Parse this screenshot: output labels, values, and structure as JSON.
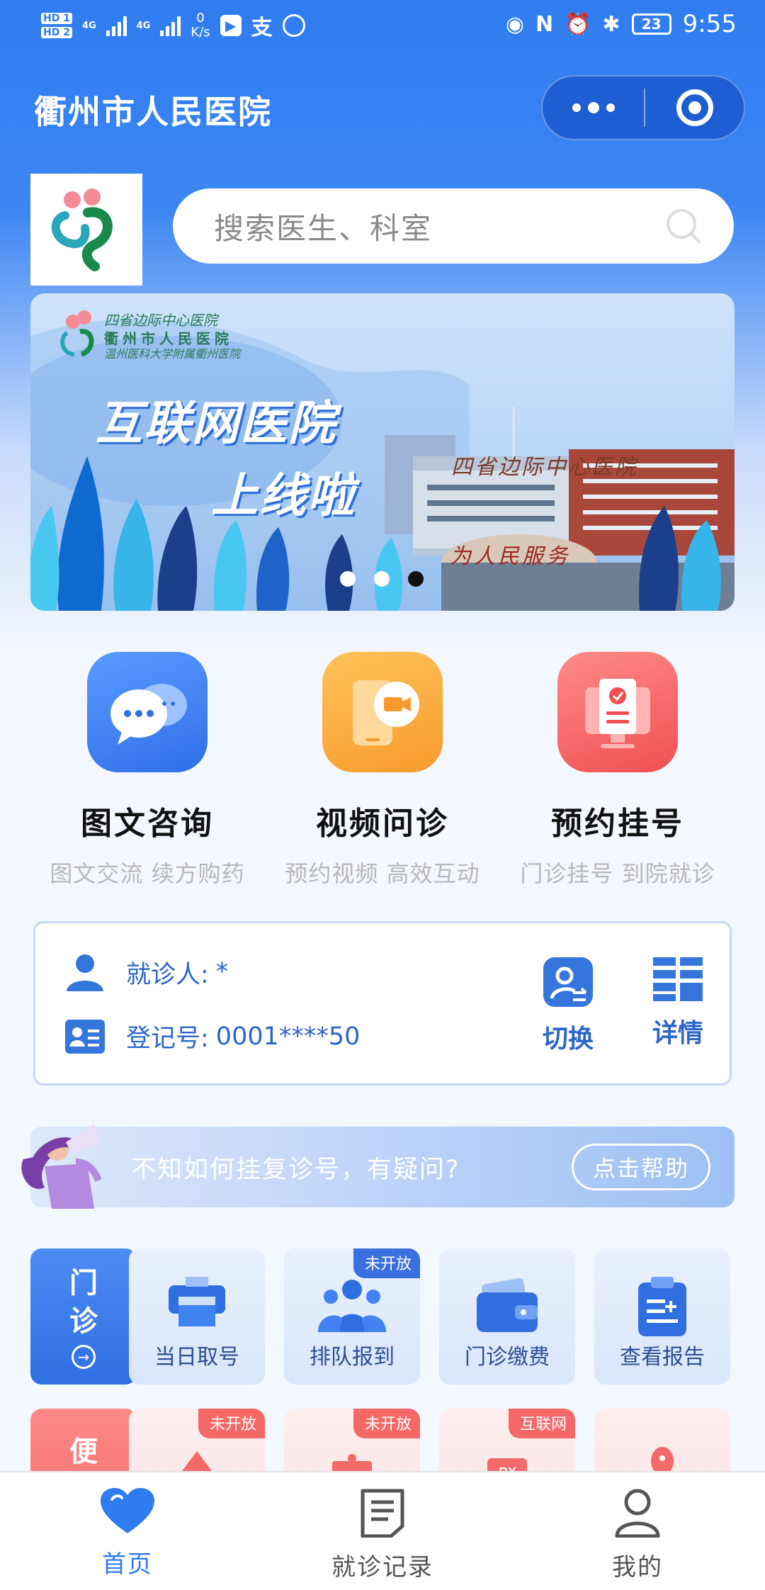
{
  "status_bar": {
    "hd1": "HD 1",
    "hd2": "HD 2",
    "net1": "4G",
    "net2": "4G",
    "speed_value": "0",
    "speed_unit": "K/s",
    "app_label": "支",
    "battery": "23",
    "time": "9:55"
  },
  "header": {
    "title": "衢州市人民医院"
  },
  "search": {
    "placeholder": "搜索医生、科室"
  },
  "banner": {
    "title_line1": "互联网医院",
    "title_line2": "上线啦",
    "org_line1": "四省边际中心医院",
    "org_line2": "衢州市人民医院",
    "org_line3": "温州医科大学附属衢州医院",
    "building_sign": "四省边际中心医院",
    "rock_text": "为人民服务",
    "slide_count": 3,
    "active_slide": 3
  },
  "services": [
    {
      "name": "图文咨询",
      "desc": "图文交流 续方购药",
      "icon": "chat-bubbles-icon",
      "color": "#3f7ff0"
    },
    {
      "name": "视频问诊",
      "desc": "预约视频 高效互动",
      "icon": "video-phone-icon",
      "color": "#f7a23b"
    },
    {
      "name": "预约挂号",
      "desc": "门诊挂号 到院就诊",
      "icon": "appointment-screen-icon",
      "color": "#f45f5f"
    }
  ],
  "patient": {
    "name_label": "就诊人:",
    "name_value": "*",
    "reg_label": "登记号:",
    "reg_value": "0001****50",
    "switch_label": "切换",
    "detail_label": "详情"
  },
  "help": {
    "text": "不知如何挂复诊号，有疑问?",
    "button": "点击帮助"
  },
  "outpatient": {
    "tag": [
      "门",
      "诊"
    ],
    "tiles": [
      {
        "label": "当日取号",
        "badge": "",
        "icon": "ticket-printer-icon"
      },
      {
        "label": "排队报到",
        "badge": "未开放",
        "icon": "queue-people-icon"
      },
      {
        "label": "门诊缴费",
        "badge": "",
        "icon": "wallet-icon"
      },
      {
        "label": "查看报告",
        "badge": "",
        "icon": "report-clipboard-icon"
      }
    ]
  },
  "convenience": {
    "tag": [
      "便"
    ],
    "tiles": [
      {
        "label": "",
        "badge": "未开放",
        "icon": "ticket-icon"
      },
      {
        "label": "",
        "badge": "未开放",
        "icon": "tag-icon"
      },
      {
        "label": "",
        "badge": "互联网",
        "icon": "prescription-rx-icon"
      },
      {
        "label": "",
        "badge": "",
        "icon": "mouse-icon"
      }
    ]
  },
  "tabbar": {
    "tabs": [
      {
        "label": "首页",
        "active": true,
        "icon": "heart-icon"
      },
      {
        "label": "就诊记录",
        "active": false,
        "icon": "document-icon"
      },
      {
        "label": "我的",
        "active": false,
        "icon": "user-icon"
      }
    ]
  },
  "colors": {
    "primary": "#2f7cf0",
    "text_blue": "#2c66c8",
    "badge_blue": "#3a6fe0",
    "badge_red": "#f56868"
  }
}
